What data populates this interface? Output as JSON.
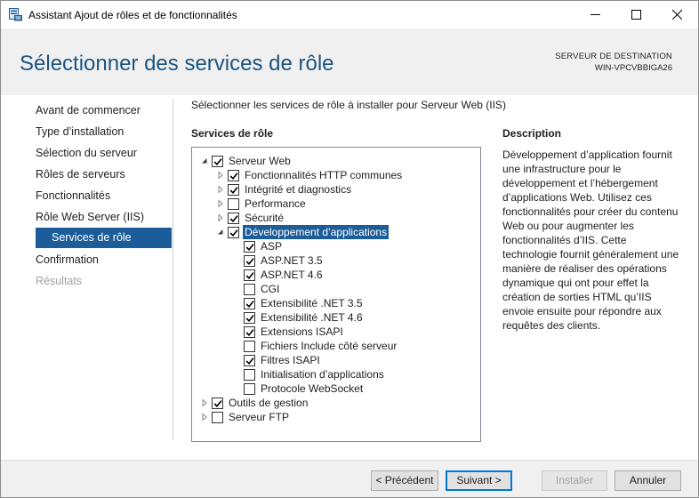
{
  "window": {
    "title": "Assistant Ajout de rôles et de fonctionnalités"
  },
  "header": {
    "page_title": "Sélectionner des services de rôle",
    "destination_label": "SERVEUR DE DESTINATION",
    "destination_value": "WIN-VPCVBBIGA26"
  },
  "nav": {
    "items": [
      {
        "label": "Avant de commencer",
        "state": "normal"
      },
      {
        "label": "Type d’installation",
        "state": "normal"
      },
      {
        "label": "Sélection du serveur",
        "state": "normal"
      },
      {
        "label": "Rôles de serveurs",
        "state": "normal"
      },
      {
        "label": "Fonctionnalités",
        "state": "normal"
      },
      {
        "label": "Rôle Web Server (IIS)",
        "state": "normal"
      },
      {
        "label": "Services de rôle",
        "state": "active"
      },
      {
        "label": "Confirmation",
        "state": "normal"
      },
      {
        "label": "Résultats",
        "state": "disabled"
      }
    ]
  },
  "main": {
    "intro": "Sélectionner les services de rôle à installer pour Serveur Web (IIS)",
    "services_heading": "Services de rôle",
    "description_heading": "Description",
    "description_text": "Développement d’application fournit une infrastructure pour le développement et l’hébergement d’applications Web. Utilisez ces fonctionnalités pour créer du contenu Web ou pour augmenter les fonctionnalités d’IIS. Cette technologie fournit généralement une manière de réaliser des opérations dynamique qui ont pour effet la création de sorties HTML qu’IIS envoie ensuite pour répondre aux requêtes des clients.",
    "tree": [
      {
        "label": "Serveur Web",
        "level": 0,
        "expander": "expanded",
        "checked": true,
        "selected": false
      },
      {
        "label": "Fonctionnalités HTTP communes",
        "level": 1,
        "expander": "collapsed",
        "checked": true,
        "selected": false
      },
      {
        "label": "Intégrité et diagnostics",
        "level": 1,
        "expander": "collapsed",
        "checked": true,
        "selected": false
      },
      {
        "label": "Performance",
        "level": 1,
        "expander": "collapsed",
        "checked": false,
        "selected": false
      },
      {
        "label": "Sécurité",
        "level": 1,
        "expander": "collapsed",
        "checked": true,
        "selected": false
      },
      {
        "label": "Développement d’applications",
        "level": 1,
        "expander": "expanded",
        "checked": true,
        "selected": true
      },
      {
        "label": "ASP",
        "level": 2,
        "expander": "none",
        "checked": true,
        "selected": false
      },
      {
        "label": "ASP.NET 3.5",
        "level": 2,
        "expander": "none",
        "checked": true,
        "selected": false
      },
      {
        "label": "ASP.NET 4.6",
        "level": 2,
        "expander": "none",
        "checked": true,
        "selected": false
      },
      {
        "label": "CGI",
        "level": 2,
        "expander": "none",
        "checked": false,
        "selected": false
      },
      {
        "label": "Extensibilité .NET 3.5",
        "level": 2,
        "expander": "none",
        "checked": true,
        "selected": false
      },
      {
        "label": "Extensibilité .NET 4.6",
        "level": 2,
        "expander": "none",
        "checked": true,
        "selected": false
      },
      {
        "label": "Extensions ISAPI",
        "level": 2,
        "expander": "none",
        "checked": true,
        "selected": false
      },
      {
        "label": "Fichiers Include côté serveur",
        "level": 2,
        "expander": "none",
        "checked": false,
        "selected": false
      },
      {
        "label": "Filtres ISAPI",
        "level": 2,
        "expander": "none",
        "checked": true,
        "selected": false
      },
      {
        "label": "Initialisation d’applications",
        "level": 2,
        "expander": "none",
        "checked": false,
        "selected": false
      },
      {
        "label": "Protocole WebSocket",
        "level": 2,
        "expander": "none",
        "checked": false,
        "selected": false
      },
      {
        "label": "Outils de gestion",
        "level": 0,
        "expander": "collapsed",
        "checked": true,
        "selected": false
      },
      {
        "label": "Serveur FTP",
        "level": 0,
        "expander": "collapsed",
        "checked": false,
        "selected": false
      }
    ]
  },
  "footer": {
    "previous_label": "< Précédent",
    "next_label": "Suivant >",
    "install_label": "Installer",
    "cancel_label": "Annuler"
  },
  "colors": {
    "accent": "#1c5d99",
    "title_blue": "#1c5480",
    "header_bg": "#f0f0f0"
  },
  "icons": [
    "server-manager-icon",
    "minimize-icon",
    "maximize-icon",
    "close-icon",
    "expand-arrow-icon",
    "collapse-arrow-icon",
    "checkmark-icon"
  ]
}
